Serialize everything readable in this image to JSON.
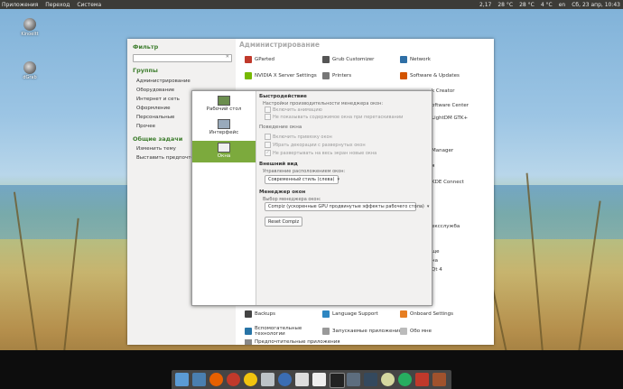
{
  "topbar": {
    "menus": [
      "Приложения",
      "Переход",
      "Система"
    ],
    "indicators": [
      "2,17",
      "28 °C",
      "28 °C",
      "4 °C",
      "en",
      "Сб, 23 апр, 10:43"
    ]
  },
  "desktop": {
    "icons": [
      {
        "label": "Kinoeltt"
      },
      {
        "label": "dGrab"
      }
    ]
  },
  "filter": {
    "title": "Фильтр",
    "search_placeholder": ""
  },
  "groups": {
    "title": "Группы",
    "items": [
      "Администрирование",
      "Оборудование",
      "Интернет и сеть",
      "Оформление",
      "Персональные",
      "Прочее"
    ]
  },
  "common_tasks": {
    "title": "Общие задачи",
    "items": [
      "Изменить тему",
      "Выставить предпочтения"
    ]
  },
  "admin": {
    "title": "Администрирование",
    "apps_row1": [
      "GParted",
      "Grub Customizer",
      "Network"
    ],
    "apps_row2": [
      "NVIDIA X Server Settings",
      "Printers",
      "Software & Updates"
    ],
    "right_fragments": [
      "k Creator",
      "oftware Center",
      "LightDM GTK+",
      "Manager",
      "я",
      "KDE Connect",
      "ексслужба",
      "ще",
      "на",
      "Qt 4"
    ],
    "bottom_apps": [
      "Backups",
      "Language Support",
      "Onboard Settings",
      "Вспомогательные технологии",
      "Запускаемые приложения",
      "Обо мне",
      "Предпочтительные приложения"
    ]
  },
  "dialog": {
    "side": [
      "Рабочий стол",
      "Интерфейс",
      "Окна"
    ],
    "perf_title": "Быстродействие",
    "perf_sub": "Настройки производительности менеджера окон:",
    "perf_opts": [
      "Включить анимацию",
      "Не показывать содержимое окна при перетаскивании"
    ],
    "behav_title": "Поведение окна",
    "behav_opts": [
      "Включить привязку окон",
      "Убрать декорации с развернутых окон",
      "Не развертывать на весь экран новые окна"
    ],
    "look_title": "Внешний вид",
    "look_sub": "Управление расположением окон:",
    "look_value": "Современный стиль (слева)",
    "wm_title": "Менеджер окон",
    "wm_sub": "Выбор менеджера окон:",
    "wm_value": "Compiz (ускоренные GPU продвинутые эффекты рабочего стола)",
    "reset_label": "Reset Compiz"
  },
  "dock": {
    "icons": [
      "finder-icon",
      "desktop-icon",
      "firefox-icon",
      "settings-icon",
      "notes-icon",
      "mail-icon",
      "thunderbird-icon",
      "people-icon",
      "files-icon",
      "terminal-icon",
      "calculator-icon",
      "monitor-icon",
      "onion-icon",
      "eye-icon",
      "tools-icon",
      "archive-icon"
    ]
  },
  "colors": {
    "accent": "#7caa3d",
    "topbar": "#3c3b37",
    "section": "#3f7e2f"
  }
}
